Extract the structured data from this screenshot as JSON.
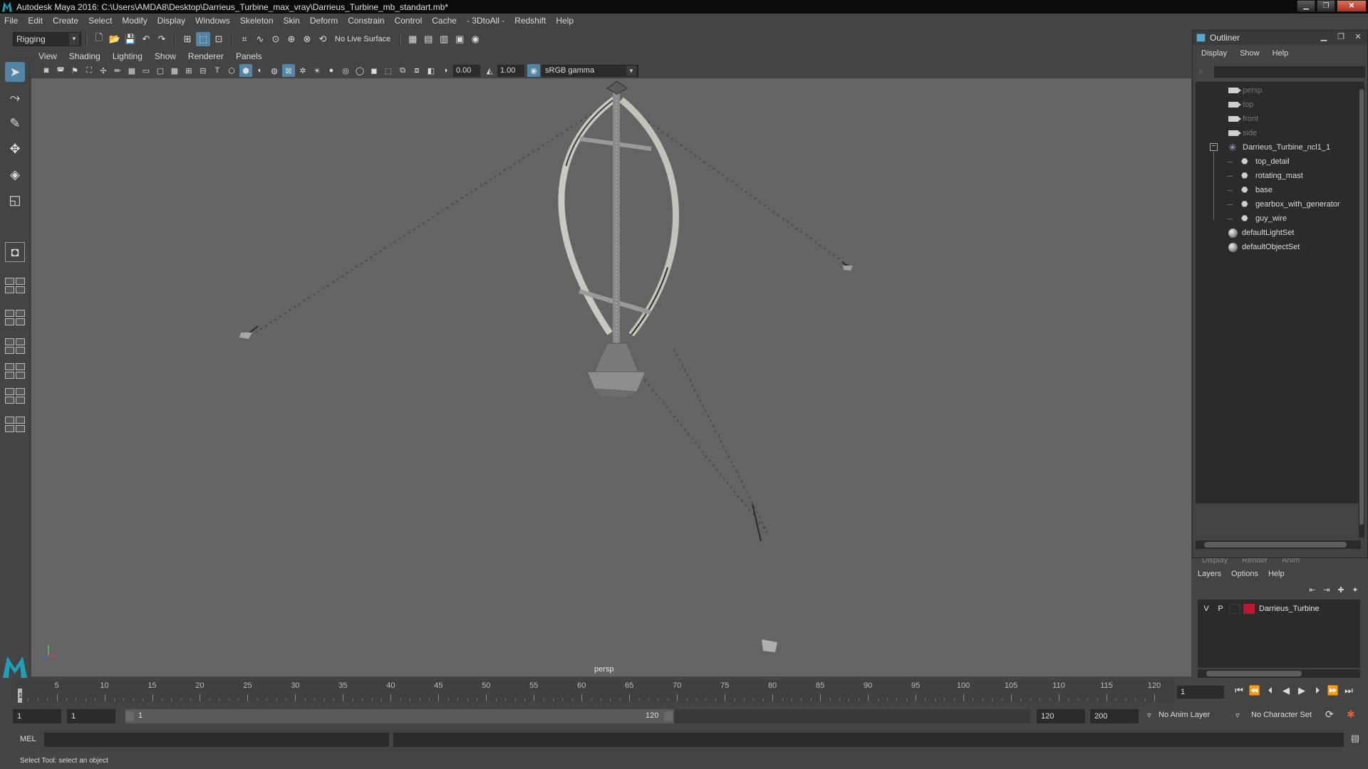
{
  "window": {
    "title": "Autodesk Maya 2016: C:\\Users\\AMDA8\\Desktop\\Darrieus_Turbine_max_vray\\Darrieus_Turbine_mb_standart.mb*",
    "minimize": "▁",
    "maximize": "❐",
    "close": "✕"
  },
  "menubar": [
    "File",
    "Edit",
    "Create",
    "Select",
    "Modify",
    "Display",
    "Windows",
    "Skeleton",
    "Skin",
    "Deform",
    "Constrain",
    "Control",
    "Cache",
    "- 3DtoAll -",
    "Redshift",
    "Help"
  ],
  "statusline": {
    "mode": "Rigging",
    "live_surface": "No Live Surface"
  },
  "viewport": {
    "menus": [
      "View",
      "Shading",
      "Lighting",
      "Show",
      "Renderer",
      "Panels"
    ],
    "exposure": "0.00",
    "gamma": "1.00",
    "color_space": "sRGB gamma",
    "camera": "persp"
  },
  "outliner": {
    "title": "Outliner",
    "menus": [
      "Display",
      "Show",
      "Help"
    ],
    "cameras": [
      "persp",
      "top",
      "front",
      "side"
    ],
    "group": "Darrieus_Turbine_ncl1_1",
    "children": [
      "top_detail",
      "rotating_mast",
      "base",
      "gearbox_with_generator",
      "guy_wire"
    ],
    "sets": [
      "defaultLightSet",
      "defaultObjectSet"
    ]
  },
  "layer_editor": {
    "tabs": [
      "Display",
      "Render",
      "Anim"
    ],
    "menus": [
      "Layers",
      "Options",
      "Help"
    ],
    "layer": {
      "visible": "V",
      "playback": "P",
      "name": "Darrieus_Turbine",
      "color": "#c0162f"
    }
  },
  "timeline": {
    "ticks": [
      "5",
      "10",
      "15",
      "20",
      "25",
      "30",
      "35",
      "40",
      "45",
      "50",
      "55",
      "60",
      "65",
      "70",
      "75",
      "80",
      "85",
      "90",
      "95",
      "100",
      "105",
      "110",
      "115",
      "120"
    ],
    "current_frame": "1",
    "current_time_field": "1"
  },
  "range": {
    "start": "1",
    "playback_start": "1",
    "range_start_label": "1",
    "range_end_label": "120",
    "playback_end": "120",
    "end": "200",
    "anim_layer": "No Anim Layer",
    "character_set": "No Character Set"
  },
  "command_line": {
    "language": "MEL"
  },
  "help_line": {
    "text": "Select Tool: select an object"
  }
}
